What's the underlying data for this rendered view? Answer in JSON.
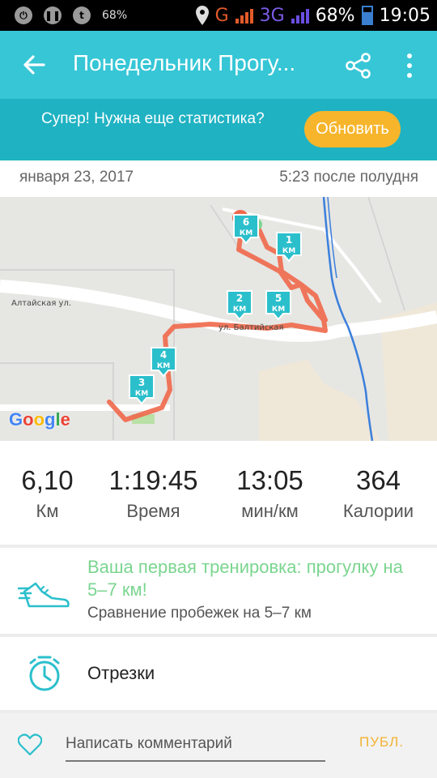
{
  "status_bar": {
    "left_percent": "68%",
    "network": "G",
    "network2": "3G",
    "battery": "68%",
    "battery_level": 0.68,
    "clock": "19:05"
  },
  "app_bar": {
    "title": "Понедельник Прогу...",
    "back_icon": "arrow-back-icon",
    "share_icon": "share-icon",
    "more_icon": "more-vert-icon",
    "color": "#36c6d6"
  },
  "promo": {
    "text": "Супер! Нужна еще статистика?",
    "button_label": "Обновить",
    "color": "#1fb2c3",
    "button_color": "#f7b52c"
  },
  "activity": {
    "date": "января 23, 2017",
    "time": "5:23 после полудня"
  },
  "map": {
    "streets": [
      "Алтайская ул.",
      "ул. Балтийская"
    ],
    "attribution": "Google",
    "route_color": "#f0684a",
    "marker_color": "#2bbfcc",
    "markers": [
      {
        "num": "1",
        "unit": "КМ"
      },
      {
        "num": "2",
        "unit": "КМ"
      },
      {
        "num": "3",
        "unit": "КМ"
      },
      {
        "num": "4",
        "unit": "КМ"
      },
      {
        "num": "5",
        "unit": "КМ"
      },
      {
        "num": "6",
        "unit": "КМ"
      }
    ]
  },
  "stats": [
    {
      "value": "6,10",
      "label": "Км"
    },
    {
      "value": "1:19:45",
      "label": "Время"
    },
    {
      "value": "13:05",
      "label": "мин/км"
    },
    {
      "value": "364",
      "label": "Калории"
    }
  ],
  "achievement": {
    "title": "Ваша первая тренировка: прогулку на 5–7 км!",
    "subtitle": "Сравнение пробежек на 5–7 км",
    "icon": "running-shoe-icon"
  },
  "splits": {
    "label": "Отрезки",
    "icon": "stopwatch-icon"
  },
  "comment": {
    "placeholder": "Написать комментарий",
    "publish_label": "ПУБЛ.",
    "like_icon": "heart-icon"
  }
}
